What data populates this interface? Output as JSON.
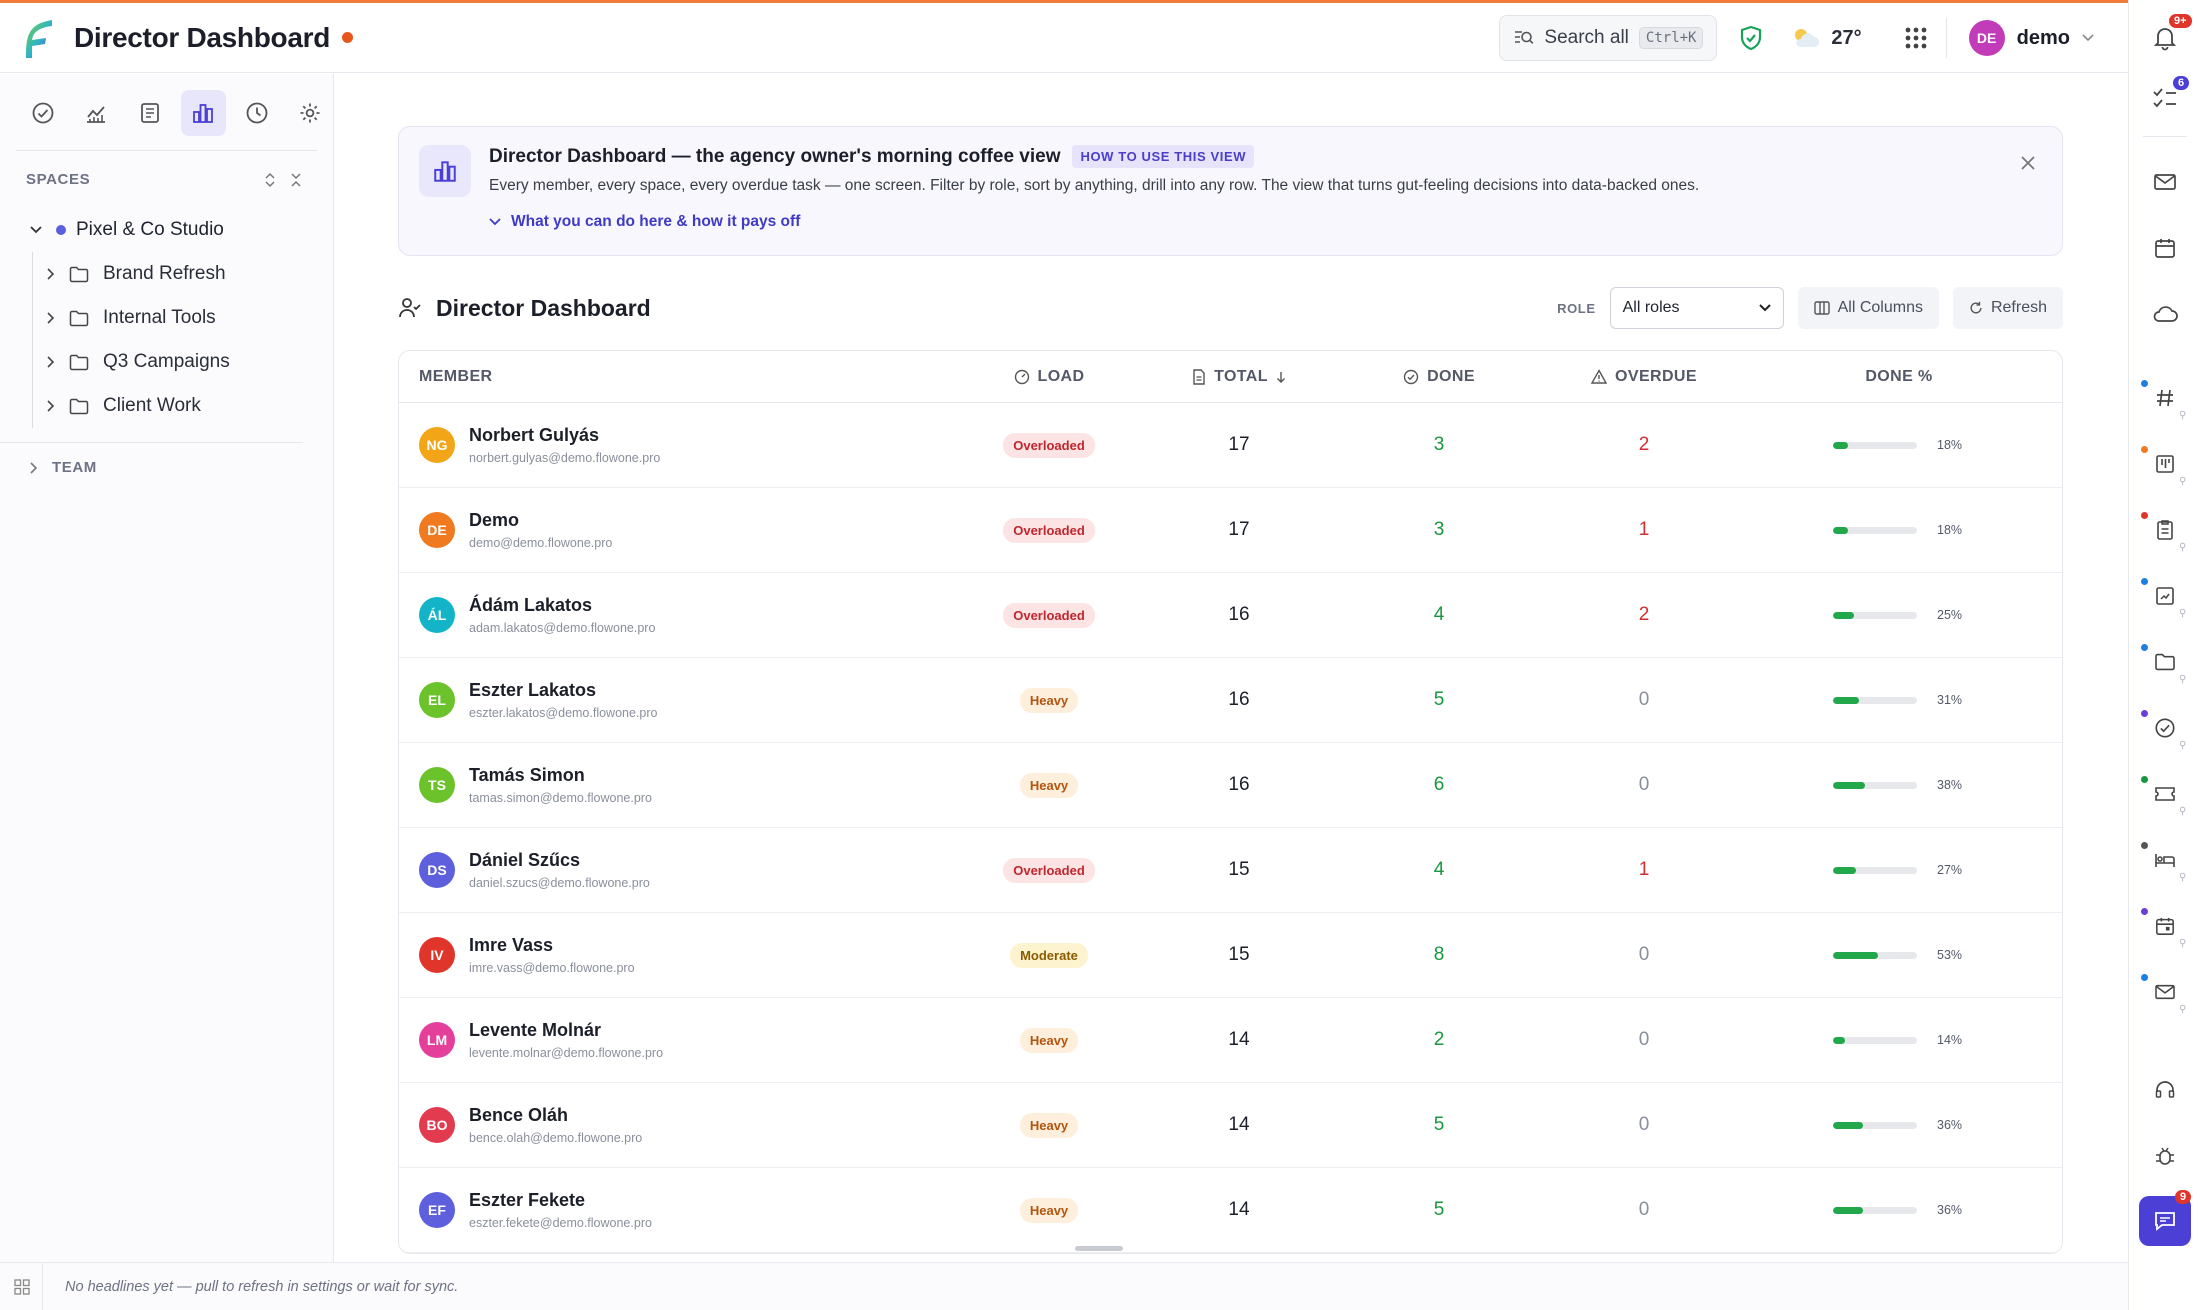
{
  "header": {
    "title": "Director Dashboard",
    "search_label": "Search all",
    "search_shortcut": "Ctrl+K",
    "temperature": "27°",
    "user_initials": "DE",
    "user_name": "demo"
  },
  "sidebar": {
    "spaces_label": "SPACES",
    "root": "Pixel & Co Studio",
    "items": [
      "Brand Refresh",
      "Internal Tools",
      "Q3 Campaigns",
      "Client Work"
    ],
    "team_label": "TEAM"
  },
  "banner": {
    "title": "Director Dashboard — the agency owner's morning coffee view",
    "badge": "HOW TO USE THIS VIEW",
    "description": "Every member, every space, every overdue task — one screen. Filter by role, sort by anything, drill into any row. The view that turns gut-feeling decisions into data-backed ones.",
    "link": "What you can do here & how it pays off"
  },
  "section": {
    "title": "Director Dashboard",
    "role_label": "ROLE",
    "role_value": "All roles",
    "columns_label": "All Columns",
    "refresh_label": "Refresh"
  },
  "table": {
    "headers": {
      "member": "MEMBER",
      "load": "LOAD",
      "total": "TOTAL",
      "done": "DONE",
      "overdue": "OVERDUE",
      "pct": "DONE %"
    },
    "rows": [
      {
        "initials": "NG",
        "color": "#f2a516",
        "name": "Norbert Gulyás",
        "email": "norbert.gulyas@demo.flowone.pro",
        "load": "Overloaded",
        "total": "17",
        "done": "3",
        "overdue": "2",
        "pct": "18%",
        "frac": 0.18
      },
      {
        "initials": "DE",
        "color": "#f07a1f",
        "name": "Demo",
        "email": "demo@demo.flowone.pro",
        "load": "Overloaded",
        "total": "17",
        "done": "3",
        "overdue": "1",
        "pct": "18%",
        "frac": 0.18
      },
      {
        "initials": "ÁL",
        "color": "#14b4c8",
        "name": "Ádám Lakatos",
        "email": "adam.lakatos@demo.flowone.pro",
        "load": "Overloaded",
        "total": "16",
        "done": "4",
        "overdue": "2",
        "pct": "25%",
        "frac": 0.25
      },
      {
        "initials": "EL",
        "color": "#6cc22b",
        "name": "Eszter Lakatos",
        "email": "eszter.lakatos@demo.flowone.pro",
        "load": "Heavy",
        "total": "16",
        "done": "5",
        "overdue": "0",
        "pct": "31%",
        "frac": 0.31
      },
      {
        "initials": "TS",
        "color": "#6cc22b",
        "name": "Tamás Simon",
        "email": "tamas.simon@demo.flowone.pro",
        "load": "Heavy",
        "total": "16",
        "done": "6",
        "overdue": "0",
        "pct": "38%",
        "frac": 0.38
      },
      {
        "initials": "DS",
        "color": "#5d5fdc",
        "name": "Dániel Szűcs",
        "email": "daniel.szucs@demo.flowone.pro",
        "load": "Overloaded",
        "total": "15",
        "done": "4",
        "overdue": "1",
        "pct": "27%",
        "frac": 0.27
      },
      {
        "initials": "IV",
        "color": "#e0352b",
        "name": "Imre Vass",
        "email": "imre.vass@demo.flowone.pro",
        "load": "Moderate",
        "total": "15",
        "done": "8",
        "overdue": "0",
        "pct": "53%",
        "frac": 0.53
      },
      {
        "initials": "LM",
        "color": "#e43f9a",
        "name": "Levente Molnár",
        "email": "levente.molnar@demo.flowone.pro",
        "load": "Heavy",
        "total": "14",
        "done": "2",
        "overdue": "0",
        "pct": "14%",
        "frac": 0.14
      },
      {
        "initials": "BO",
        "color": "#e23a4e",
        "name": "Bence Oláh",
        "email": "bence.olah@demo.flowone.pro",
        "load": "Heavy",
        "total": "14",
        "done": "5",
        "overdue": "0",
        "pct": "36%",
        "frac": 0.36
      },
      {
        "initials": "EF",
        "color": "#5d5fdc",
        "name": "Eszter Fekete",
        "email": "eszter.fekete@demo.flowone.pro",
        "load": "Heavy",
        "total": "14",
        "done": "5",
        "overdue": "0",
        "pct": "36%",
        "frac": 0.36
      }
    ]
  },
  "rail": {
    "notifications_badge": "9+",
    "tasks_badge": "6",
    "chat_badge": "9"
  },
  "footer": {
    "text": "No headlines yet — pull to refresh in settings or wait for sync."
  },
  "colors": {
    "accent": "#4b3fd6",
    "brand_orange": "#f07b3a",
    "done_green": "#22a84a",
    "overdue_red": "#d12f2f"
  }
}
